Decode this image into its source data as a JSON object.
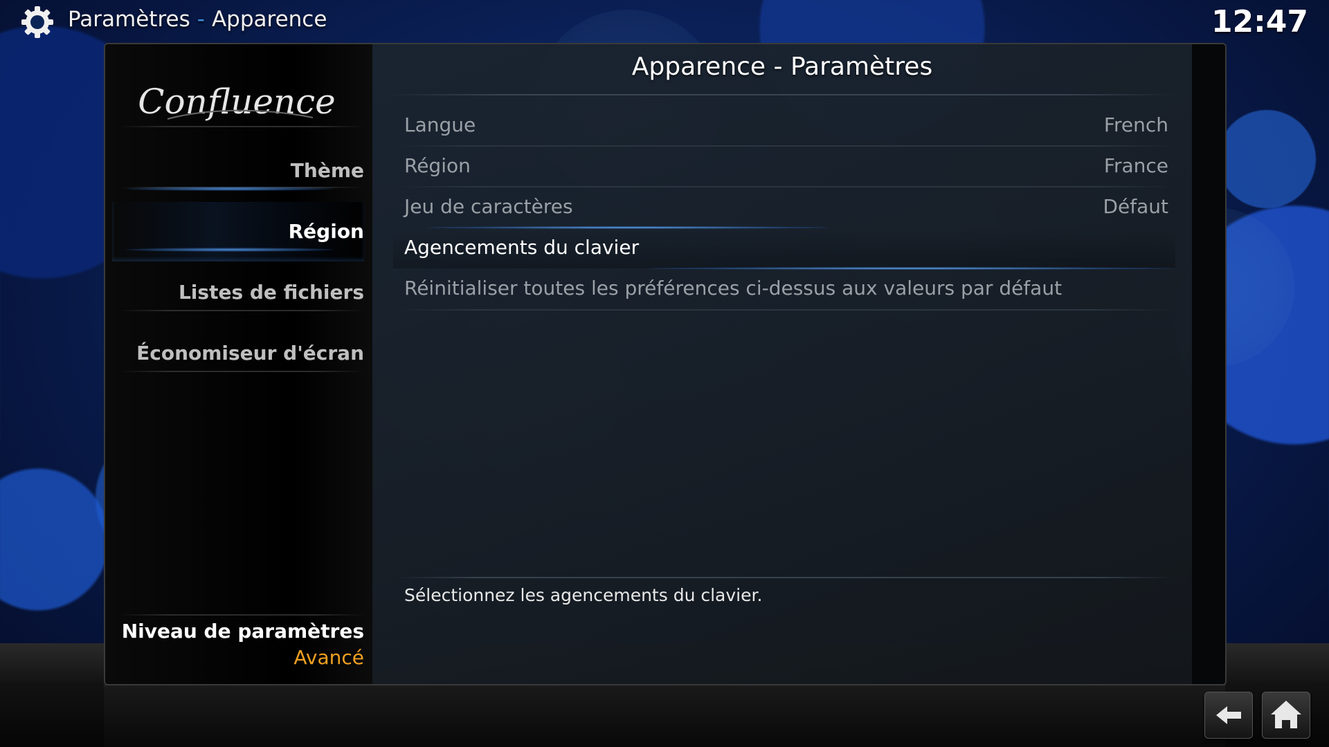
{
  "header": {
    "breadcrumb": [
      "Paramètres",
      "-",
      "Apparence"
    ],
    "clock": "12:47"
  },
  "sidebar": {
    "logo_text": "Confluence",
    "items": [
      {
        "label": "Thème",
        "active": false
      },
      {
        "label": "Région",
        "active": true
      },
      {
        "label": "Listes de fichiers",
        "active": false
      },
      {
        "label": "Économiseur d'écran",
        "active": false
      }
    ],
    "settings_level": {
      "label": "Niveau de paramètres",
      "value": "Avancé"
    }
  },
  "dialog": {
    "title": "Apparence - Paramètres",
    "close_label": "✕",
    "settings": [
      {
        "label": "Langue",
        "value": "French"
      },
      {
        "label": "Région",
        "value": "France"
      },
      {
        "label": "Jeu de caractères",
        "value": "Défaut"
      },
      {
        "label": "Agencements du clavier",
        "value": ""
      },
      {
        "label": "Réinitialiser toutes les préférences ci-dessus aux valeurs par défaut",
        "value": ""
      }
    ],
    "description": "Sélectionnez les agencements du clavier."
  },
  "footer": {
    "back_icon": "back-arrow-icon",
    "home_icon": "home-icon"
  },
  "colors": {
    "accent": "#3a8fdc",
    "level_value": "#f0a020"
  }
}
